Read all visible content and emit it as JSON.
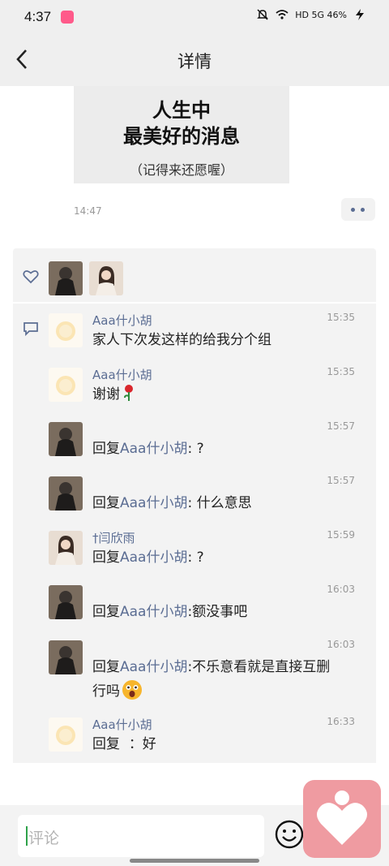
{
  "status_bar": {
    "time": "4:37",
    "indicators": "HD 5G 46%"
  },
  "header": {
    "title": "详情",
    "back_icon": "chevron-left-icon"
  },
  "post": {
    "image_text": {
      "line1": "人生中",
      "line2": "最美好的消息",
      "line3": "（记得来还愿喔）"
    },
    "time": "14:47",
    "more_icon": "more-dots-icon"
  },
  "likes": {
    "icon": "heart-outline-icon",
    "count": 2
  },
  "comments": [
    {
      "author": "Aaa什小胡",
      "time": "15:35",
      "text": "家人下次发这样的给我分个组"
    },
    {
      "author": "Aaa什小胡",
      "time": "15:35",
      "text": "谢谢"
    },
    {
      "author": "",
      "time": "15:57",
      "reply_prefix": "回复",
      "reply_to": "Aaa什小胡",
      "colon": ":",
      "text": "?"
    },
    {
      "author": "",
      "time": "15:57",
      "reply_prefix": "回复",
      "reply_to": "Aaa什小胡",
      "colon": ":",
      "text": "什么意思"
    },
    {
      "author": "†闫欣雨",
      "time": "15:59",
      "reply_prefix": "回复",
      "reply_to": "Aaa什小胡",
      "colon": ":",
      "text": "?"
    },
    {
      "author": "",
      "time": "16:03",
      "reply_prefix": "回复",
      "reply_to": "Aaa什小胡",
      "colon": ":",
      "text": "额没事吧"
    },
    {
      "author": "",
      "time": "16:03",
      "reply_prefix": "回复",
      "reply_to": "Aaa什小胡",
      "colon": ":",
      "text": "不乐意看就是直接互删",
      "text2": "行吗"
    },
    {
      "author": "Aaa什小胡",
      "time": "16:33",
      "reply_prefix": "回复",
      "text": "：好"
    }
  ],
  "bottom": {
    "input_placeholder": "评论",
    "emoji_icon": "smiley-icon"
  },
  "colors": {
    "link": "#5b6d93",
    "panel": "#f3f3f3",
    "bar": "#efefef",
    "float_app": "#ef9ba1"
  }
}
